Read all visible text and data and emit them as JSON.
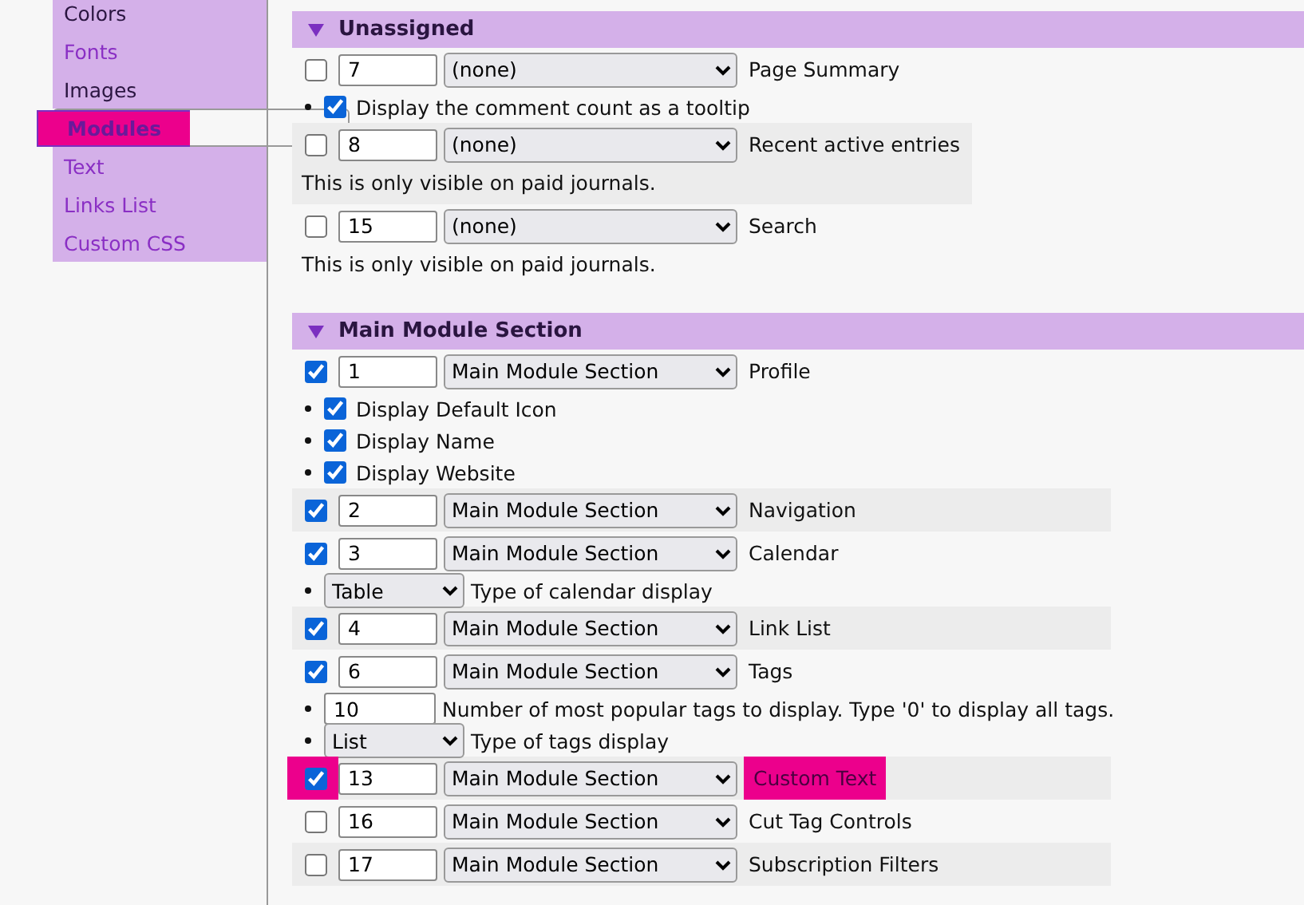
{
  "sidebar": {
    "items": [
      {
        "label": "Colors",
        "selected": false,
        "visited": true,
        "highlighted": false
      },
      {
        "label": "Fonts",
        "selected": false,
        "visited": false,
        "highlighted": false
      },
      {
        "label": "Images",
        "selected": false,
        "visited": true,
        "highlighted": false
      },
      {
        "label": "Modules",
        "selected": true,
        "visited": false,
        "highlighted": true
      },
      {
        "label": "Text",
        "selected": false,
        "visited": false,
        "highlighted": false
      },
      {
        "label": "Links List",
        "selected": false,
        "visited": false,
        "highlighted": false
      },
      {
        "label": "Custom CSS",
        "selected": false,
        "visited": false,
        "highlighted": false
      }
    ]
  },
  "sections": [
    {
      "title": "Unassigned",
      "expanded": true,
      "modules": [
        {
          "checked": false,
          "order": "7",
          "section": "(none)",
          "name": "Page Summary",
          "highlighted": false,
          "options": [
            {
              "kind": "checkbox",
              "checked": true,
              "label": "Display the comment count as a tooltip"
            }
          ]
        },
        {
          "checked": false,
          "order": "8",
          "section": "(none)",
          "name": "Recent active entries",
          "highlighted": false,
          "note": "This is only visible on paid journals."
        },
        {
          "checked": false,
          "order": "15",
          "section": "(none)",
          "name": "Search",
          "highlighted": false,
          "note": "This is only visible on paid journals."
        }
      ]
    },
    {
      "title": "Main Module Section",
      "expanded": true,
      "modules": [
        {
          "checked": true,
          "order": "1",
          "section": "Main Module Section",
          "name": "Profile",
          "highlighted": false,
          "options": [
            {
              "kind": "checkbox",
              "checked": true,
              "label": "Display Default Icon"
            },
            {
              "kind": "checkbox",
              "checked": true,
              "label": "Display Name"
            },
            {
              "kind": "checkbox",
              "checked": true,
              "label": "Display Website"
            }
          ]
        },
        {
          "checked": true,
          "order": "2",
          "section": "Main Module Section",
          "name": "Navigation",
          "highlighted": false
        },
        {
          "checked": true,
          "order": "3",
          "section": "Main Module Section",
          "name": "Calendar",
          "highlighted": false,
          "options": [
            {
              "kind": "select",
              "value": "Table",
              "label": "Type of calendar display"
            }
          ]
        },
        {
          "checked": true,
          "order": "4",
          "section": "Main Module Section",
          "name": "Link List",
          "highlighted": false
        },
        {
          "checked": true,
          "order": "6",
          "section": "Main Module Section",
          "name": "Tags",
          "highlighted": false,
          "options": [
            {
              "kind": "number",
              "value": "10",
              "label": "Number of most popular tags to display. Type '0' to display all tags."
            },
            {
              "kind": "select",
              "value": "List",
              "label": "Type of tags display"
            }
          ]
        },
        {
          "checked": true,
          "order": "13",
          "section": "Main Module Section",
          "name": "Custom Text",
          "highlighted": true
        },
        {
          "checked": false,
          "order": "16",
          "section": "Main Module Section",
          "name": "Cut Tag Controls",
          "highlighted": false
        },
        {
          "checked": false,
          "order": "17",
          "section": "Main Module Section",
          "name": "Subscription Filters",
          "highlighted": false
        }
      ]
    }
  ]
}
